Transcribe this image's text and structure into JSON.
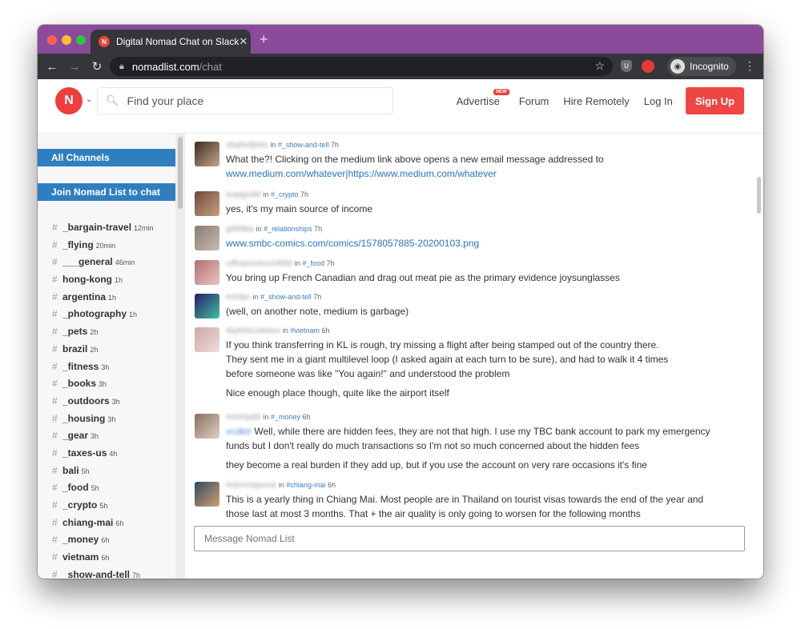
{
  "browser": {
    "tab_title": "Digital Nomad Chat on Slack",
    "tab_close": "✕",
    "new_tab": "+",
    "url_host": "nomadlist.com",
    "url_path": "/chat",
    "incognito_label": "Incognito"
  },
  "header": {
    "search_placeholder": "Find your place",
    "nav": {
      "advertise": "Advertise",
      "new_badge": "NEW",
      "forum": "Forum",
      "hire": "Hire Remotely",
      "login": "Log In",
      "signup": "Sign Up"
    }
  },
  "sidebar": {
    "all_channels": "All Channels",
    "join": "Join Nomad List to chat",
    "channels": [
      {
        "name": "_bargain-travel",
        "time": "12min"
      },
      {
        "name": "_flying",
        "time": "20min"
      },
      {
        "name": "___general",
        "time": "46min"
      },
      {
        "name": "hong-kong",
        "time": "1h"
      },
      {
        "name": "argentina",
        "time": "1h"
      },
      {
        "name": "_photography",
        "time": "1h"
      },
      {
        "name": "_pets",
        "time": "2h"
      },
      {
        "name": "brazil",
        "time": "2h"
      },
      {
        "name": "_fitness",
        "time": "3h"
      },
      {
        "name": "_books",
        "time": "3h"
      },
      {
        "name": "_outdoors",
        "time": "3h"
      },
      {
        "name": "_housing",
        "time": "3h"
      },
      {
        "name": "_gear",
        "time": "3h"
      },
      {
        "name": "_taxes-us",
        "time": "4h"
      },
      {
        "name": "bali",
        "time": "5h"
      },
      {
        "name": "_food",
        "time": "5h"
      },
      {
        "name": "_crypto",
        "time": "5h"
      },
      {
        "name": "chiang-mai",
        "time": "6h"
      },
      {
        "name": "_money",
        "time": "6h"
      },
      {
        "name": "vietnam",
        "time": "6h"
      },
      {
        "name": "_show-and-tell",
        "time": "7h"
      }
    ]
  },
  "messages": [
    {
      "user": "okqrkxfjbvtx",
      "in": "in",
      "channel": "#_show-and-tell",
      "time": "7h",
      "lines": [
        {
          "text": "What the?! Clicking on the medium link above opens a new email message addressed to"
        },
        {
          "link": "www.medium.com/whatever|https://www.medium.com/whatever"
        }
      ]
    },
    {
      "user": "tuqagodie",
      "in": "in",
      "channel": "#_crypto",
      "time": "7h",
      "lines": [
        {
          "text": "yes, it's my main source of income"
        }
      ]
    },
    {
      "user": "gtbfdlax",
      "in": "in",
      "channel": "#_relationships",
      "time": "7h",
      "lines": [
        {
          "link": "www.smbc-comics.com/comics/1578057885-20200103.png"
        }
      ]
    },
    {
      "user": "vdbvpmztncontkbb",
      "in": "in",
      "channel": "#_food",
      "time": "7h",
      "lines": [
        {
          "text": "You bring up French Canadian and drag out meat pie as the primary evidence joysunglasses"
        }
      ]
    },
    {
      "user": "evtvlpc",
      "in": "in",
      "channel": "#_show-and-tell",
      "time": "7h",
      "lines": [
        {
          "text": "(well, on another note, medium is garbage)"
        }
      ]
    },
    {
      "user": "dsphidxzakwuo",
      "in": "in",
      "channel": "#vietnam",
      "time": "6h",
      "lines": [
        {
          "text": "If you think transferring in KL is rough, try missing a flight after being stamped out of the country there."
        },
        {
          "text": "They sent me in a giant multilevel loop (I asked again at each turn to be sure), and had to walk it 4 times"
        },
        {
          "text": "before someone was like \"You again!\" and understood the problem"
        },
        {
          "text": "Nice enough place though, quite like the airport itself"
        }
      ]
    },
    {
      "user": "mmtnpabi",
      "in": "in",
      "channel": "#_money",
      "time": "6h",
      "lines": [
        {
          "mention": "vcdktr",
          "text": "Well, while there are hidden fees, they are not that high. I use my TBC bank account to park my emergency"
        },
        {
          "text": "funds but I don't really do much transactions so I'm not so much concerned about the hidden fees"
        },
        {
          "text": "they become a real burden if they add up, but if you use the account on very rare occasions it's fine"
        }
      ]
    },
    {
      "user": "iivdvnmqwooe",
      "in": "in",
      "channel": "#chiang-mai",
      "time": "6h",
      "lines": [
        {
          "text": "This is a yearly thing in Chiang Mai. Most people are in Thailand on tourist visas towards the end of the year and"
        },
        {
          "text": "those last at most 3 months. That + the air quality is only going to worsen for the following months"
        }
      ]
    }
  ],
  "composer": {
    "placeholder": "Message Nomad List"
  }
}
